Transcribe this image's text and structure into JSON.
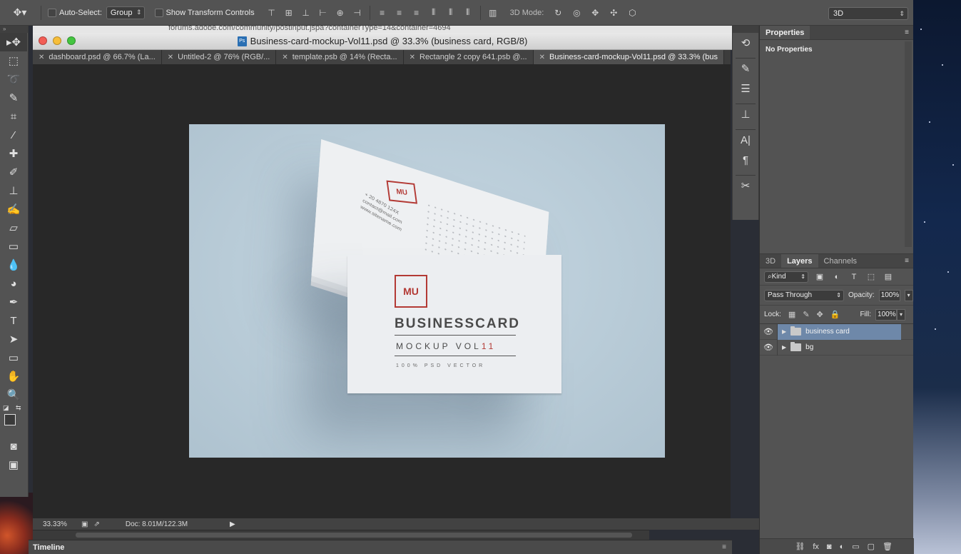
{
  "browser": {
    "url_fragment": "forums.adobe.com/community/postinput.jspa?containerType=14&container=4694"
  },
  "options_bar": {
    "auto_select_label": "Auto-Select:",
    "auto_select_value": "Group",
    "transform_controls_label": "Show Transform Controls",
    "mode_3d_label": "3D Mode:",
    "workspace_value": "3D"
  },
  "document": {
    "title": "Business-card-mockup-Vol11.psd @ 33.3% (business card, RGB/8)",
    "psd_icon": "Ps"
  },
  "tabs": [
    {
      "label": "dashboard.psd @ 66.7% (La..."
    },
    {
      "label": "Untitled-2 @ 76% (RGB/..."
    },
    {
      "label": "template.psb @ 14% (Recta..."
    },
    {
      "label": "Rectangle 2 copy 641.psb @..."
    },
    {
      "label": "Business-card-mockup-Vol11.psd @ 33.3% (bus"
    }
  ],
  "artwork": {
    "logo": "MU",
    "title": "BUSINESSCARD",
    "subtitle_main": "MOCKUP VOL",
    "subtitle_num": "11",
    "tagline": "100% PSD VECTOR",
    "back_text": "+ 20 4870 124X\ncontact@mail.com\nwww.sitename.com"
  },
  "status": {
    "zoom": "33.33%",
    "doc_size": "Doc: 8.01M/122.3M"
  },
  "timeline": {
    "label": "Timeline"
  },
  "properties_panel": {
    "tab": "Properties",
    "body": "No Properties"
  },
  "layers_panel": {
    "tabs": [
      "3D",
      "Layers",
      "Channels"
    ],
    "active_tab": "Layers",
    "filter_kind": "Kind",
    "blend_mode": "Pass Through",
    "opacity_label": "Opacity:",
    "opacity_value": "100%",
    "lock_label": "Lock:",
    "fill_label": "Fill:",
    "fill_value": "100%",
    "layers": [
      {
        "name": "business card",
        "type": "group",
        "selected": true
      },
      {
        "name": "bg",
        "type": "group",
        "selected": false
      }
    ]
  },
  "icons": {
    "tools": [
      "move-tool-icon",
      "marquee-tool-icon",
      "lasso-tool-icon",
      "quick-select-tool-icon",
      "crop-tool-icon",
      "eyedropper-tool-icon",
      "healing-brush-tool-icon",
      "brush-tool-icon",
      "clone-stamp-tool-icon",
      "history-brush-tool-icon",
      "eraser-tool-icon",
      "gradient-tool-icon",
      "blur-tool-icon",
      "dodge-tool-icon",
      "pen-tool-icon",
      "type-tool-icon",
      "path-select-tool-icon",
      "shape-tool-icon",
      "hand-tool-icon",
      "zoom-tool-icon"
    ]
  }
}
